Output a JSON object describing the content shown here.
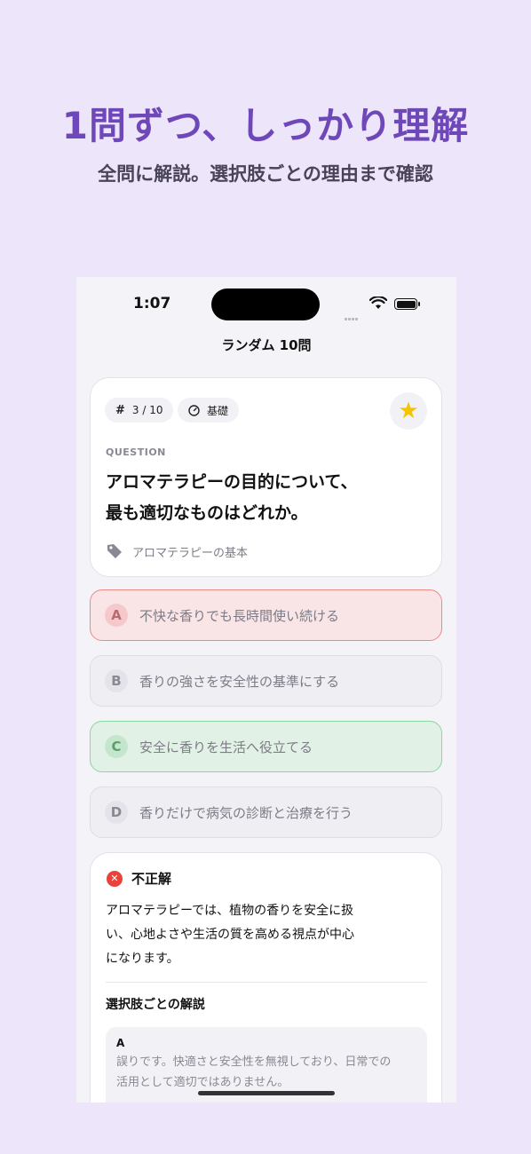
{
  "promo": {
    "title": "1問ずつ、しっかり理解",
    "subtitle": "全問に解説。選択肢ごとの理由まで確認"
  },
  "status_bar": {
    "time": "1:07"
  },
  "nav": {
    "title": "ランダム 10問"
  },
  "question_card": {
    "counter_label": "3 / 10",
    "level_label": "基礎",
    "section_label": "QUESTION",
    "question_line1": "アロマテラピーの目的について、",
    "question_line2": "最も適切なものはどれか。",
    "tag": "アロマテラピーの基本",
    "favorited": true
  },
  "options": [
    {
      "letter": "A",
      "text": "不快な香りでも長時間使い続ける",
      "state": "wrong"
    },
    {
      "letter": "B",
      "text": "香りの強さを安全性の基準にする",
      "state": "neutral"
    },
    {
      "letter": "C",
      "text": "安全に香りを生活へ役立てる",
      "state": "correct"
    },
    {
      "letter": "D",
      "text": "香りだけで病気の診断と治療を行う",
      "state": "neutral"
    }
  ],
  "explanation": {
    "result_label": "不正解",
    "body_line1": "アロマテラピーでは、植物の香りを安全に扱",
    "body_line2": "い、心地よさや生活の質を高める視点が中心",
    "body_line3": "になります。",
    "per_choice_heading": "選択肢ごとの解説",
    "items": [
      {
        "letter": "A",
        "line1": "誤りです。快適さと安全性を無視しており、日常での",
        "line2": "活用として適切ではありません。"
      }
    ]
  },
  "colors": {
    "background": "#ede5fa",
    "promo_title": "#6e48b8",
    "wrong": "#ee8a86",
    "correct": "#8dd69e",
    "star": "#f5c400",
    "error_icon": "#e8423a"
  }
}
